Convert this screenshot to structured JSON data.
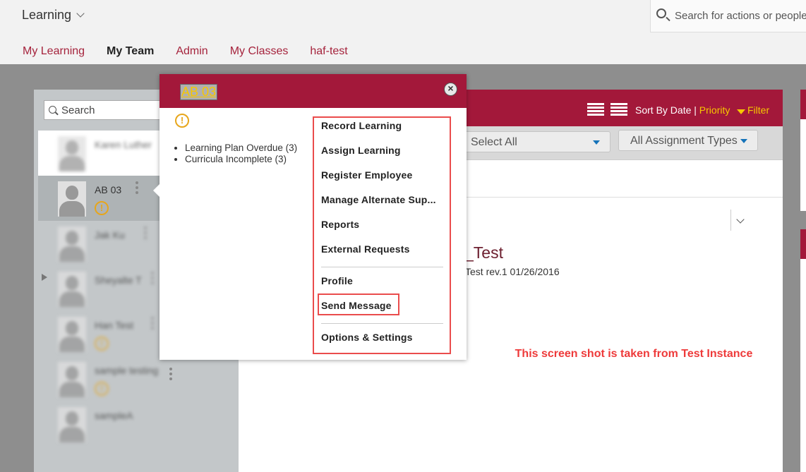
{
  "header": {
    "app_title": "Learning",
    "search_placeholder": "Search for actions or people"
  },
  "nav": {
    "tabs": [
      {
        "label": "My Learning",
        "active": false
      },
      {
        "label": "My Team",
        "active": true
      },
      {
        "label": "Admin",
        "active": false
      },
      {
        "label": "My Classes",
        "active": false
      },
      {
        "label": "haf-test",
        "active": false
      }
    ]
  },
  "team_panel": {
    "search_placeholder": "Search",
    "members": [
      {
        "name": "Karen Luther",
        "blurred": true,
        "warning": false
      },
      {
        "name": "AB 03",
        "blurred": false,
        "warning": true,
        "selected": true
      },
      {
        "name": "Jak Ku",
        "blurred": true,
        "warning": false
      },
      {
        "name": "Sheyalte T",
        "blurred": true,
        "warning": false
      },
      {
        "name": "Han Test",
        "blurred": true,
        "warning": true
      },
      {
        "name": "sample testing",
        "blurred": true,
        "warning": true
      },
      {
        "name": "sampleA",
        "blurred": true,
        "warning": false
      }
    ]
  },
  "main": {
    "sort_label": "Sort By Date",
    "sort_separator": " | ",
    "sort_priority": "Priority",
    "filter_label": "Filter",
    "select_all": "Select All",
    "assignment_types": "All Assignment Types",
    "course_title": "_Test",
    "course_subtitle": "Test rev.1 01/26/2016",
    "note": "This screen shot is taken from Test Instance"
  },
  "popup": {
    "title": "AB 03",
    "close_glyph": "×",
    "issues": [
      "Learning Plan Overdue (3)",
      "Curricula Incomplete (3)"
    ],
    "actions": {
      "record_learning": "Record Learning",
      "assign_learning": "Assign Learning",
      "register_employee": "Register Employee",
      "manage_alternate": "Manage Alternate Sup...",
      "reports": "Reports",
      "external_requests": "External Requests",
      "profile": "Profile",
      "send_message": "Send Message",
      "options_settings": "Options & Settings"
    }
  },
  "colors": {
    "brand": "#a3183a",
    "accent_yellow": "#f6c700",
    "nav_link": "#a5233c",
    "highlight_red": "#ea4c4c",
    "warning": "#e7a61b"
  },
  "icons": [
    "chevron-down-icon",
    "search-icon",
    "list-view-icon",
    "detail-view-icon",
    "filter-icon",
    "close-icon",
    "warning-icon",
    "kebab-menu-icon",
    "avatar-icon"
  ]
}
